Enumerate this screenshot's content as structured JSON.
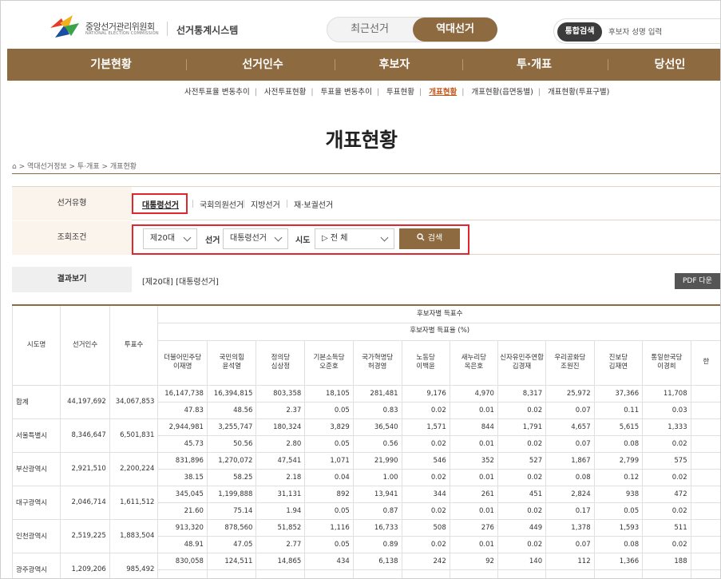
{
  "header": {
    "org_name": "중앙선거관리위원회",
    "org_name_en": "NATIONAL ELECTION COMMISSION",
    "system_title": "선거통계시스템",
    "toggle_recent": "최근선거",
    "toggle_past": "역대선거",
    "search_button": "통합검색",
    "search_placeholder": "후보자 성명 입력"
  },
  "nav": [
    "기본현황",
    "선거인수",
    "후보자",
    "투·개표",
    "당선인"
  ],
  "subnav": {
    "items": [
      "사전투표율 변동추이",
      "사전투표현황",
      "투표율 변동추이",
      "투표현황",
      "개표현황",
      "개표현황(읍면동별)",
      "개표현황(투표구별)"
    ],
    "active_index": 4
  },
  "page_title": "개표현황",
  "breadcrumb": "⌂ > 역대선거정보 > 투·개표 > 개표현황",
  "filter": {
    "type_label": "선거유형",
    "types": [
      "대통령선거",
      "국회의원선거",
      "지방선거",
      "재·보궐선거"
    ],
    "active_type": "대통령선거",
    "cond_label": "조회조건",
    "term_value": "제20대",
    "election_label": "선거",
    "election_value": "대통령선거",
    "sido_label": "시도",
    "sido_value": "▷ 전 체",
    "search_label": "검색"
  },
  "result": {
    "label": "결과보기",
    "value": "[제20대] [대통령선거]",
    "pdf_label": "PDF 다운"
  },
  "table": {
    "h_region": "시도명",
    "h_electors": "선거인수",
    "h_voters": "투표수",
    "h_candidate_votes": "후보자별 득표수",
    "h_candidate_rate": "후보자별 득표율 (%)",
    "candidates": [
      {
        "party": "더불어민주당",
        "name": "이재명"
      },
      {
        "party": "국민의힘",
        "name": "윤석열"
      },
      {
        "party": "정의당",
        "name": "심상정"
      },
      {
        "party": "기본소득당",
        "name": "오준호"
      },
      {
        "party": "국가혁명당",
        "name": "허경영"
      },
      {
        "party": "노동당",
        "name": "이백윤"
      },
      {
        "party": "새누리당",
        "name": "옥은호"
      },
      {
        "party": "신자유민주연합",
        "name": "김경재"
      },
      {
        "party": "우리공화당",
        "name": "조원진"
      },
      {
        "party": "진보당",
        "name": "김재연"
      },
      {
        "party": "통일한국당",
        "name": "이경희"
      },
      {
        "party": "한",
        "name": ""
      }
    ],
    "rows": [
      {
        "region": "합계",
        "electors": "44,197,692",
        "voters": "34,067,853",
        "votes": [
          "16,147,738",
          "16,394,815",
          "803,358",
          "18,105",
          "281,481",
          "9,176",
          "4,970",
          "8,317",
          "25,972",
          "37,366",
          "11,708",
          ""
        ],
        "rates": [
          "47.83",
          "48.56",
          "2.37",
          "0.05",
          "0.83",
          "0.02",
          "0.01",
          "0.02",
          "0.07",
          "0.11",
          "0.03",
          ""
        ]
      },
      {
        "region": "서울특별시",
        "electors": "8,346,647",
        "voters": "6,501,831",
        "votes": [
          "2,944,981",
          "3,255,747",
          "180,324",
          "3,829",
          "36,540",
          "1,571",
          "844",
          "1,791",
          "4,657",
          "5,615",
          "1,333",
          ""
        ],
        "rates": [
          "45.73",
          "50.56",
          "2.80",
          "0.05",
          "0.56",
          "0.02",
          "0.01",
          "0.02",
          "0.07",
          "0.08",
          "0.02",
          ""
        ]
      },
      {
        "region": "부산광역시",
        "electors": "2,921,510",
        "voters": "2,200,224",
        "votes": [
          "831,896",
          "1,270,072",
          "47,541",
          "1,071",
          "21,990",
          "546",
          "352",
          "527",
          "1,867",
          "2,799",
          "575",
          ""
        ],
        "rates": [
          "38.15",
          "58.25",
          "2.18",
          "0.04",
          "1.00",
          "0.02",
          "0.01",
          "0.02",
          "0.08",
          "0.12",
          "0.02",
          ""
        ]
      },
      {
        "region": "대구광역시",
        "electors": "2,046,714",
        "voters": "1,611,512",
        "votes": [
          "345,045",
          "1,199,888",
          "31,131",
          "892",
          "13,941",
          "344",
          "261",
          "451",
          "2,824",
          "938",
          "472",
          ""
        ],
        "rates": [
          "21.60",
          "75.14",
          "1.94",
          "0.05",
          "0.87",
          "0.02",
          "0.01",
          "0.02",
          "0.17",
          "0.05",
          "0.02",
          ""
        ]
      },
      {
        "region": "인천광역시",
        "electors": "2,519,225",
        "voters": "1,883,504",
        "votes": [
          "913,320",
          "878,560",
          "51,852",
          "1,116",
          "16,733",
          "508",
          "276",
          "449",
          "1,378",
          "1,593",
          "511",
          ""
        ],
        "rates": [
          "48.91",
          "47.05",
          "2.77",
          "0.05",
          "0.89",
          "0.02",
          "0.01",
          "0.02",
          "0.07",
          "0.08",
          "0.02",
          ""
        ]
      },
      {
        "region": "광주광역시",
        "electors": "1,209,206",
        "voters": "985,492",
        "votes": [
          "830,058",
          "124,511",
          "14,865",
          "434",
          "6,138",
          "242",
          "92",
          "140",
          "112",
          "1,366",
          "188",
          ""
        ],
        "rates": [
          "",
          "",
          "",
          "",
          "",
          "",
          "",
          "",
          "",
          "",
          "",
          ""
        ]
      }
    ]
  },
  "colors": {
    "brand": "#8d6a3f",
    "highlight": "#e2262e",
    "active_link": "#c2571d"
  }
}
